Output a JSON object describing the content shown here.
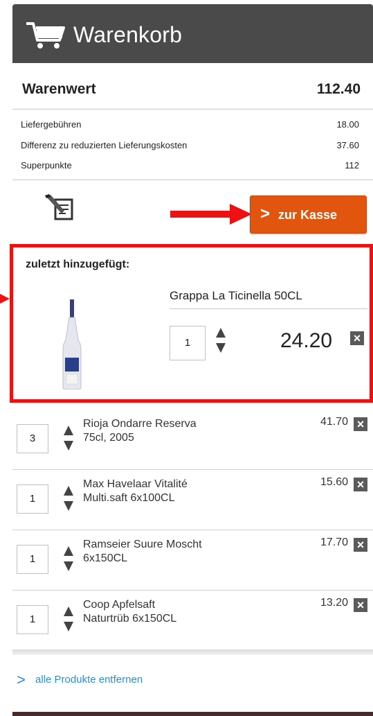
{
  "header": {
    "title": "Warenkorb",
    "icon": "shopping-cart-icon"
  },
  "summary": {
    "label": "Warenwert",
    "value": "112.40"
  },
  "fees": [
    {
      "label": "Liefergebühren",
      "value": "18.00"
    },
    {
      "label": "Differenz zu reduzierten Lieferungskosten",
      "value": "37.60"
    },
    {
      "label": "Superpunkte",
      "value": "112"
    }
  ],
  "checkout": {
    "chevron": ">",
    "label": "zur Kasse",
    "color": "#e2550f"
  },
  "last_added": {
    "caption": "zuletzt hinzugefügt:",
    "name": "Grappa La Ticinella 50CL",
    "qty": "1",
    "price": "24.20"
  },
  "items": [
    {
      "name_line1": "Rioja Ondarre Reserva",
      "name_line2": "75cl, 2005",
      "qty": "3",
      "price": "41.70"
    },
    {
      "name_line1": "Max Havelaar Vitalité",
      "name_line2": "Multi.saft 6x100CL",
      "qty": "1",
      "price": "15.60"
    },
    {
      "name_line1": "Ramseier Suure Moscht",
      "name_line2": "6x150CL",
      "qty": "1",
      "price": "17.70"
    },
    {
      "name_line1": "Coop Apfelsaft",
      "name_line2": "Naturtrüb 6x150CL",
      "qty": "1",
      "price": "13.20"
    }
  ],
  "footer": {
    "remove_chevron": ">",
    "remove_label": "alle Produkte entfernen"
  },
  "colors": {
    "header_bg": "#4a4a4a",
    "highlight": "#ee1111",
    "link": "#2b8fd6"
  }
}
